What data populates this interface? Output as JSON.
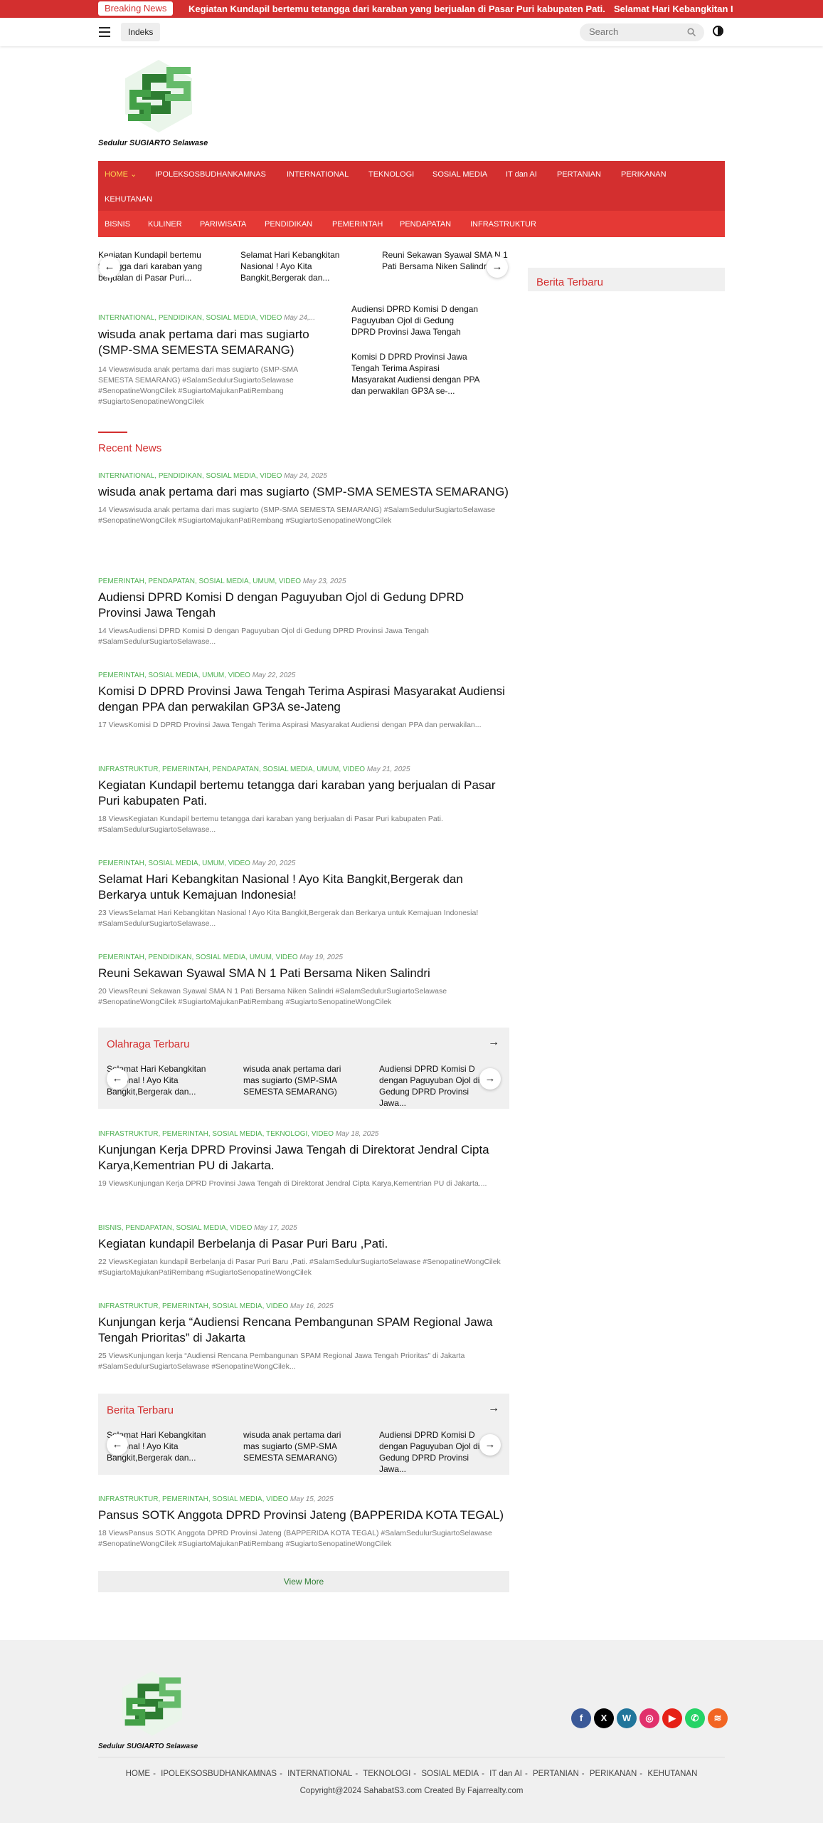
{
  "topbar": {
    "label": "Breaking News",
    "items": [
      "Kegiatan Kundapil bertemu tetangga dari karaban yang berjualan di Pasar Puri kabupaten Pati.",
      "Selamat Hari Kebangkitan I"
    ]
  },
  "header": {
    "indeks": "Indeks",
    "search_placeholder": "Search"
  },
  "logo": {
    "text": "Sedulur SUGIARTO Selawase"
  },
  "nav": {
    "row1": [
      "HOME",
      "IPOLEKSOSBUDHANKAMNAS",
      "INTERNATIONAL",
      "TEKNOLOGI",
      "SOSIAL MEDIA",
      "IT dan AI",
      "PERTANIAN",
      "PERIKANAN",
      "KEHUTANAN"
    ],
    "row2": [
      "BISNIS",
      "KULINER",
      "PARIWISATA",
      "PENDIDIKAN",
      "PEMERINTAH",
      "PENDAPATAN",
      "INFRASTRUKTUR"
    ]
  },
  "headline_slider": [
    "Kegiatan Kundapil bertemu tetangga dari karaban yang berjualan di Pasar Puri...",
    "Selamat Hari Kebangkitan Nasional ! Ayo Kita Bangkit,Bergerak dan...",
    "Reuni Sekawan Syawal SMA N 1 Pati Bersama Niken Salindri"
  ],
  "featured": {
    "cats": "INTERNATIONAL, PENDIDIKAN, SOSIAL MEDIA, VIDEO",
    "date": "May 24,...",
    "title": "wisuda anak pertama dari mas sugiarto (SMP-SMA SEMESTA SEMARANG)",
    "excerpt": "14 Viewswisuda anak pertama dari mas sugiarto (SMP-SMA SEMESTA SEMARANG) #SalamSedulurSugiartoSelawase #SenopatineWongCilek #SugiartoMajukanPatiRembang #SugiartoSenopatineWongCilek"
  },
  "side_list": [
    "Audiensi DPRD Komisi D dengan Paguyuban Ojol di Gedung DPRD Provinsi Jawa Tengah",
    "Komisi D DPRD Provinsi Jawa Tengah Terima Aspirasi Masyarakat Audiensi dengan PPA dan perwakilan GP3A se-..."
  ],
  "recent_title": "Recent News",
  "posts": [
    {
      "cats": "INTERNATIONAL, PENDIDIKAN, SOSIAL MEDIA, VIDEO",
      "date": "May 24, 2025",
      "title": "wisuda anak pertama dari mas sugiarto (SMP-SMA SEMESTA SEMARANG)",
      "excerpt": "14 Viewswisuda anak pertama dari mas sugiarto (SMP-SMA SEMESTA SEMARANG) #SalamSedulurSugiartoSelawase #SenopatineWongCilek #SugiartoMajukanPatiRembang #SugiartoSenopatineWongCilek"
    },
    {
      "cats": "PEMERINTAH, PENDAPATAN, SOSIAL MEDIA, UMUM, VIDEO",
      "date": "May 23, 2025",
      "title": "Audiensi DPRD Komisi D dengan Paguyuban Ojol di Gedung DPRD Provinsi Jawa Tengah",
      "excerpt": "14 ViewsAudiensi DPRD Komisi D dengan Paguyuban Ojol di Gedung DPRD Provinsi Jawa Tengah #SalamSedulurSugiartoSelawase..."
    },
    {
      "cats": "PEMERINTAH, SOSIAL MEDIA, UMUM, VIDEO",
      "date": "May 22, 2025",
      "title": "Komisi D DPRD Provinsi Jawa Tengah Terima Aspirasi Masyarakat Audiensi dengan PPA dan perwakilan GP3A se-Jateng",
      "excerpt": "17 ViewsKomisi D DPRD Provinsi Jawa Tengah Terima Aspirasi Masyarakat Audiensi dengan PPA dan perwakilan..."
    },
    {
      "cats": "INFRASTRUKTUR, PEMERINTAH, PENDAPATAN, SOSIAL MEDIA, UMUM, VIDEO",
      "date": "May 21, 2025",
      "title": "Kegiatan Kundapil bertemu tetangga dari karaban yang berjualan di Pasar Puri kabupaten Pati.",
      "excerpt": "18 ViewsKegiatan Kundapil bertemu tetangga dari karaban yang berjualan di Pasar Puri kabupaten Pati. #SalamSedulurSugiartoSelawase..."
    },
    {
      "cats": "PEMERINTAH, SOSIAL MEDIA, UMUM, VIDEO",
      "date": "May 20, 2025",
      "title": "Selamat Hari Kebangkitan Nasional ! Ayo Kita Bangkit,Bergerak dan Berkarya untuk Kemajuan Indonesia!",
      "excerpt": "23 ViewsSelamat Hari Kebangkitan Nasional ! Ayo Kita Bangkit,Bergerak dan Berkarya untuk Kemajuan Indonesia! #SalamSedulurSugiartoSelawase..."
    },
    {
      "cats": "PEMERINTAH, PENDIDIKAN, SOSIAL MEDIA, UMUM, VIDEO",
      "date": "May 19, 2025",
      "title": "Reuni Sekawan Syawal SMA N 1 Pati Bersama Niken Salindri",
      "excerpt": "20 ViewsReuni Sekawan Syawal SMA N 1 Pati Bersama Niken Salindri #SalamSedulurSugiartoSelawase #SenopatineWongCilek #SugiartoMajukanPatiRembang #SugiartoSenopatineWongCilek"
    },
    {
      "cats": "INFRASTRUKTUR, PEMERINTAH, SOSIAL MEDIA, TEKNOLOGI, VIDEO",
      "date": "May 18, 2025",
      "title": "Kunjungan Kerja DPRD Provinsi Jawa Tengah di Direktorat Jendral Cipta Karya,Kementrian PU di Jakarta.",
      "excerpt": "19 ViewsKunjungan Kerja DPRD Provinsi Jawa Tengah di Direktorat Jendral Cipta Karya,Kementrian PU di Jakarta...."
    },
    {
      "cats": "BISNIS, PENDAPATAN, SOSIAL MEDIA, VIDEO",
      "date": "May 17, 2025",
      "title": "Kegiatan kundapil Berbelanja di Pasar Puri Baru ,Pati.",
      "excerpt": "22 ViewsKegiatan kundapil Berbelanja di Pasar Puri Baru ,Pati. #SalamSedulurSugiartoSelawase #SenopatineWongCilek #SugiartoMajukanPatiRembang #SugiartoSenopatineWongCilek"
    },
    {
      "cats": "INFRASTRUKTUR, PEMERINTAH, SOSIAL MEDIA, VIDEO",
      "date": "May 16, 2025",
      "title": "Kunjungan kerja “Audiensi Rencana Pembangunan SPAM Regional Jawa Tengah Prioritas” di Jakarta",
      "excerpt": "25 ViewsKunjungan kerja “Audiensi Rencana Pembangunan SPAM Regional Jawa Tengah Prioritas” di Jakarta #SalamSedulurSugiartoSelawase #SenopatineWongCilek..."
    },
    {
      "cats": "INFRASTRUKTUR, PEMERINTAH, SOSIAL MEDIA, VIDEO",
      "date": "May 15, 2025",
      "title": "Pansus SOTK Anggota DPRD Provinsi Jateng (BAPPERIDA KOTA TEGAL)",
      "excerpt": "18 ViewsPansus SOTK Anggota DPRD Provinsi Jateng (BAPPERIDA KOTA TEGAL) #SalamSedulurSugiartoSelawase #SenopatineWongCilek #SugiartoMajukanPatiRembang #SugiartoSenopatineWongCilek"
    }
  ],
  "box1": {
    "title": "Olahraga Terbaru",
    "items": [
      "Selamat Hari Kebangkitan Nasional ! Ayo Kita Bangkit,Bergerak dan...",
      "wisuda anak pertama dari mas sugiarto (SMP-SMA SEMESTA SEMARANG)",
      "Audiensi DPRD Komisi D dengan Paguyuban Ojol di Gedung DPRD Provinsi Jawa..."
    ]
  },
  "box2": {
    "title": "Berita Terbaru",
    "items": [
      "Selamat Hari Kebangkitan Nasional ! Ayo Kita Bangkit,Bergerak dan...",
      "wisuda anak pertama dari mas sugiarto (SMP-SMA SEMESTA SEMARANG)",
      "Audiensi DPRD Komisi D dengan Paguyuban Ojol di Gedung DPRD Provinsi Jawa..."
    ]
  },
  "sidebar": {
    "title": "Berita Terbaru"
  },
  "view_more": "View More",
  "footer": {
    "logo_text": "Sedulur SUGIARTO Selawase",
    "menu": [
      "HOME",
      "IPOLEKSOSBUDHANKAMNAS",
      "INTERNATIONAL",
      "TEKNOLOGI",
      "SOSIAL MEDIA",
      "IT dan AI",
      "PERTANIAN",
      "PERIKANAN",
      "KEHUTANAN"
    ],
    "separator": "-",
    "copyright": "Copyright@2024 SahabatS3.com Created By Fajarrealty.com",
    "socials": [
      {
        "name": "facebook",
        "glyph": "f",
        "color": "#3b5998"
      },
      {
        "name": "x",
        "glyph": "X",
        "color": "#000000"
      },
      {
        "name": "wordpress",
        "glyph": "W",
        "color": "#21759b"
      },
      {
        "name": "instagram",
        "glyph": "◎",
        "color": "#e1306c"
      },
      {
        "name": "youtube",
        "glyph": "▶",
        "color": "#e62117"
      },
      {
        "name": "whatsapp",
        "glyph": "✆",
        "color": "#25d366"
      },
      {
        "name": "rss",
        "glyph": "≋",
        "color": "#f26522"
      }
    ]
  },
  "arrows": {
    "prev": "←",
    "next": "→"
  },
  "colors": {
    "brand": "#d32f2f",
    "category": "#4caf50",
    "nav_active": "#ffd54f"
  }
}
